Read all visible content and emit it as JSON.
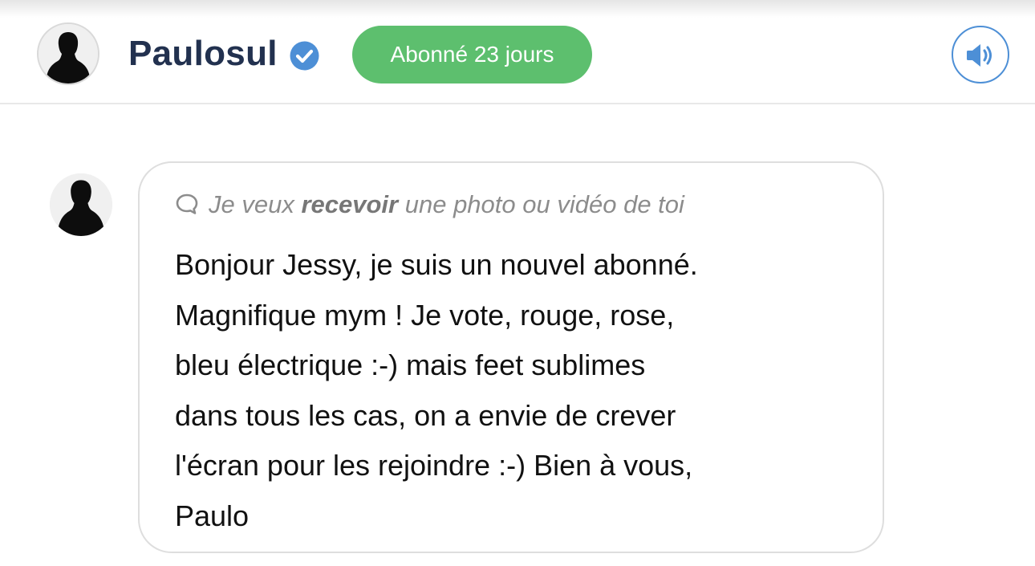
{
  "header": {
    "username": "Paulosul",
    "verified_icon": "verified-check-icon",
    "subscription_badge": "Abonné 23 jours",
    "sound_icon": "speaker-icon",
    "avatar_icon": "person-silhouette-icon"
  },
  "message": {
    "avatar_icon": "person-silhouette-icon",
    "request": {
      "icon": "chat-bubble-icon",
      "prefix": "Je veux",
      "emphasis": "recevoir",
      "suffix": "une photo ou vidéo de toi"
    },
    "lines": [
      "Bonjour Jessy, je suis un nouvel abonné.",
      "Magnifique mym ! Je vote, rouge, rose,",
      "bleu électrique :-) mais feet sublimes",
      "dans tous les cas, on a envie de crever",
      "l'écran pour les rejoindre :-) Bien à vous,",
      "Paulo"
    ]
  },
  "colors": {
    "username": "#22314f",
    "badge_bg": "#5dbf6e",
    "verified": "#4d8fd6",
    "sound_border": "#4d8fd6",
    "request_text": "#8c8c8c"
  }
}
